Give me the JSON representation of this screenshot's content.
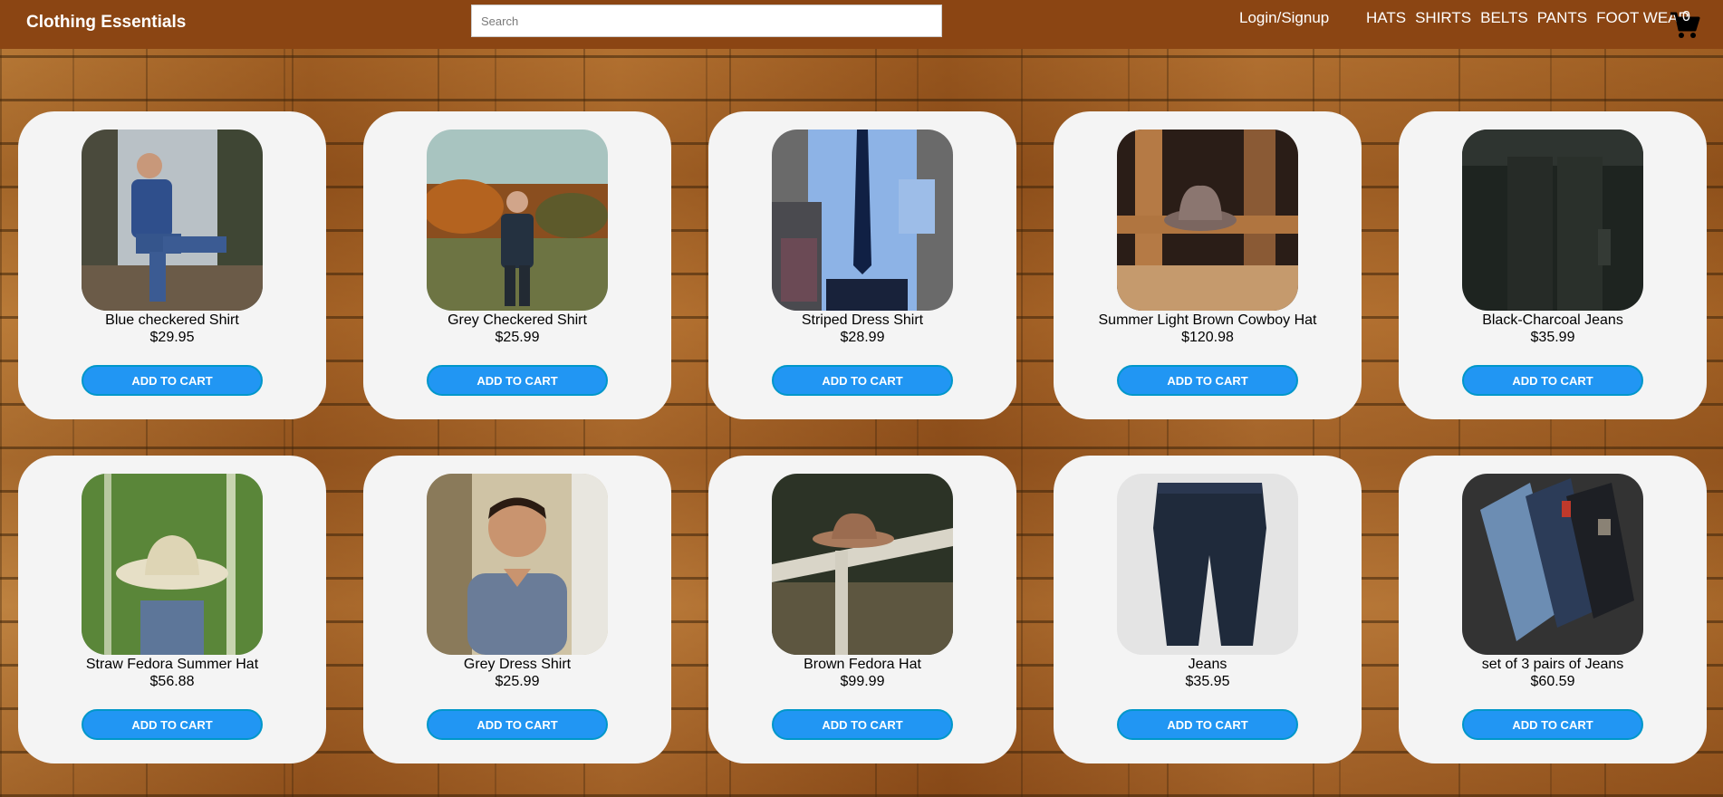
{
  "header": {
    "brand": "Clothing Essentials",
    "search_placeholder": "Search",
    "login": "Login/Signup",
    "nav": [
      "HATS",
      "SHIRTS",
      "BELTS",
      "PANTS",
      "FOOT WEAR"
    ],
    "cart_count": "0",
    "cart_icon": "shopping-cart-icon",
    "color": "#8b4513"
  },
  "button_color": "#2196f3",
  "products": [
    {
      "name": "Blue checkered Shirt",
      "price": "$29.95",
      "button": "ADD TO CART"
    },
    {
      "name": "Grey Checkered Shirt",
      "price": "$25.99",
      "button": "ADD TO CART"
    },
    {
      "name": "Striped Dress Shirt",
      "price": "$28.99",
      "button": "ADD TO CART"
    },
    {
      "name": "Summer Light Brown Cowboy Hat",
      "price": "$120.98",
      "button": "ADD TO CART"
    },
    {
      "name": "Black-Charcoal Jeans",
      "price": "$35.99",
      "button": "ADD TO CART"
    },
    {
      "name": "Straw Fedora Summer Hat",
      "price": "$56.88",
      "button": "ADD TO CART"
    },
    {
      "name": "Grey Dress Shirt",
      "price": "$25.99",
      "button": "ADD TO CART"
    },
    {
      "name": "Brown Fedora Hat",
      "price": "$99.99",
      "button": "ADD TO CART"
    },
    {
      "name": "Jeans",
      "price": "$35.95",
      "button": "ADD TO CART"
    },
    {
      "name": "set of 3 pairs of Jeans",
      "price": "$60.59",
      "button": "ADD TO CART"
    }
  ]
}
